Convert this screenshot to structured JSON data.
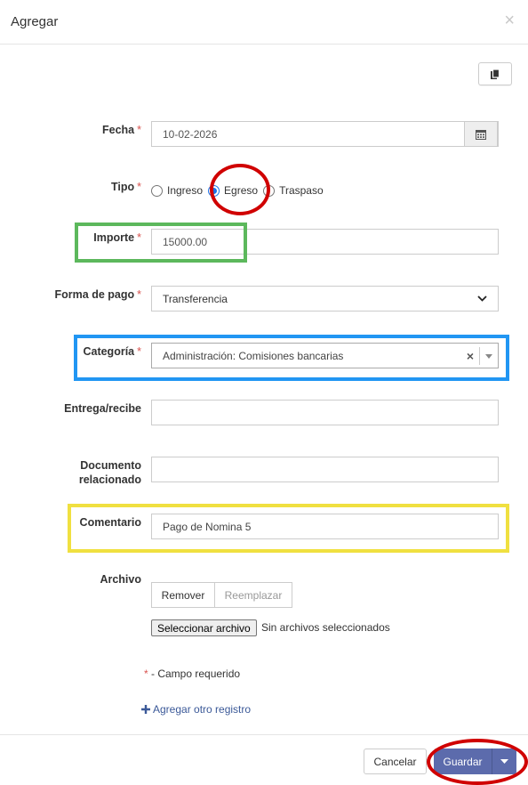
{
  "dialog": {
    "title": "Agregar"
  },
  "form": {
    "fecha": {
      "label": "Fecha",
      "required": "*",
      "value": "10-02-2026"
    },
    "tipo": {
      "label": "Tipo",
      "required": "*",
      "options": [
        "Ingreso",
        "Egreso",
        "Traspaso"
      ],
      "selected": "Egreso"
    },
    "importe": {
      "label": "Importe",
      "required": "*",
      "value": "15000.00"
    },
    "forma_pago": {
      "label": "Forma de pago",
      "required": "*",
      "value": "Transferencia"
    },
    "categoria": {
      "label": "Categoría",
      "required": "*",
      "value": "Administración: Comisiones bancarias"
    },
    "entrega": {
      "label": "Entrega/recibe",
      "value": ""
    },
    "documento": {
      "label_line1": "Documento",
      "label_line2": "relacionado",
      "value": ""
    },
    "comentario": {
      "label": "Comentario",
      "value": "Pago de Nomina 5"
    },
    "archivo": {
      "label": "Archivo",
      "remove_label": "Remover",
      "replace_label": "Reemplazar",
      "select_label": "Seleccionar archivo",
      "no_files": "Sin archivos seleccionados"
    }
  },
  "required_note": {
    "star": "*",
    "text": "- Campo requerido"
  },
  "add_another": {
    "icon": "plus-icon",
    "label": "Agregar otro registro"
  },
  "footer": {
    "cancel_label": "Cancelar",
    "save_label": "Guardar"
  },
  "colors": {
    "accent": "#5c6bac",
    "link": "#3b5998",
    "required": "#d9534f",
    "annot_red": "#d00000",
    "annot_green": "#5cb85c",
    "annot_blue": "#2196f3",
    "annot_yellow": "#f0e040"
  }
}
